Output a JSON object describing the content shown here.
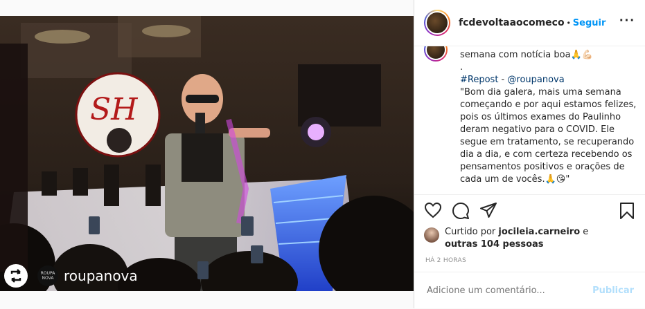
{
  "post": {
    "username": "fcdevoltaaocomeco",
    "separator": "•",
    "follow_label": "Seguir",
    "more_icon": "more-options-icon"
  },
  "photo": {
    "repost_icon": "repost-icon",
    "repost_avatar_text": "ROUPA NOVA",
    "repost_username": "roupanova",
    "drum_logo": "SH"
  },
  "caption": {
    "line1": "semana com notícia boa🙏💪🏻",
    "line2": ".",
    "hashtag": "#Repost",
    "dash": " - ",
    "mention": "@roupanova",
    "lines": [
      "\"Bom dia galera, mais uma semana",
      "começando e por aqui estamos felizes,",
      "pois os últimos exames do Paulinho",
      "deram negativo para o COVID. Ele",
      "segue em tratamento, se recuperando",
      "dia a dia, e com certeza recebendo os",
      "pensamentos positivos e orações de",
      "cada um de vocês.🙏😘\""
    ]
  },
  "likes": {
    "prefix": "Curtido por ",
    "user": "jocileia.carneiro",
    "joiner": " e",
    "others": "outras 104 pessoas"
  },
  "timestamp": "HÁ 2 HORAS",
  "comment": {
    "placeholder": "Adicione um comentário...",
    "publish_label": "Publicar"
  }
}
